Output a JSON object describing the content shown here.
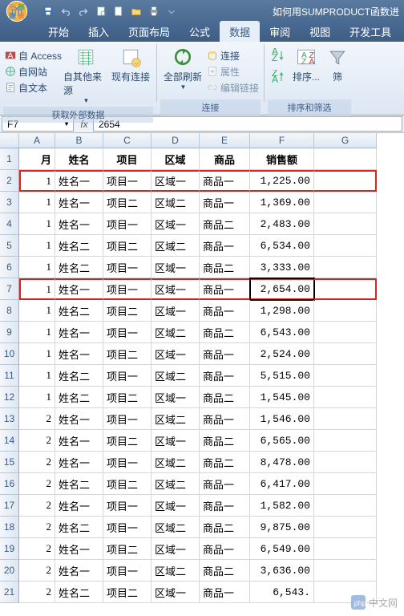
{
  "window": {
    "title": "如何用SUMPRODUCT函数进"
  },
  "tabs": [
    "开始",
    "插入",
    "页面布局",
    "公式",
    "数据",
    "审阅",
    "视图",
    "开发工具"
  ],
  "active_tab": 4,
  "ribbon": {
    "group1": {
      "label": "获取外部数据",
      "access": "自 Access",
      "web": "自网站",
      "text": "自文本",
      "other": "自其他来源",
      "existing": "现有连接"
    },
    "group2": {
      "label": "连接",
      "refresh": "全部刷新",
      "conn": "连接",
      "prop": "属性",
      "edit": "编辑链接"
    },
    "group3": {
      "label": "排序和筛选",
      "sort": "排序...",
      "filter": "筛"
    }
  },
  "namebox": "F7",
  "formula": "2654",
  "columns": [
    "",
    "A",
    "B",
    "C",
    "D",
    "E",
    "F",
    "G"
  ],
  "headers": [
    "月",
    "姓名",
    "项目",
    "区域",
    "商品",
    "销售额"
  ],
  "rows": [
    {
      "n": 1,
      "m": "1",
      "name": "姓名一",
      "proj": "项目一",
      "zone": "区域一",
      "prod": "商品一",
      "sales": "1,225.00",
      "hl": true
    },
    {
      "n": 2,
      "m": "1",
      "name": "姓名一",
      "proj": "项目二",
      "zone": "区域二",
      "prod": "商品一",
      "sales": "1,369.00"
    },
    {
      "n": 3,
      "m": "1",
      "name": "姓名一",
      "proj": "项目一",
      "zone": "区域一",
      "prod": "商品二",
      "sales": "2,483.00"
    },
    {
      "n": 4,
      "m": "1",
      "name": "姓名二",
      "proj": "项目二",
      "zone": "区域二",
      "prod": "商品一",
      "sales": "6,534.00"
    },
    {
      "n": 5,
      "m": "1",
      "name": "姓名二",
      "proj": "项目一",
      "zone": "区域一",
      "prod": "商品二",
      "sales": "3,333.00"
    },
    {
      "n": 6,
      "m": "1",
      "name": "姓名一",
      "proj": "项目一",
      "zone": "区域一",
      "prod": "商品一",
      "sales": "2,654.00",
      "hl": true,
      "active": true
    },
    {
      "n": 7,
      "m": "1",
      "name": "姓名二",
      "proj": "项目二",
      "zone": "区域一",
      "prod": "商品一",
      "sales": "1,298.00"
    },
    {
      "n": 8,
      "m": "1",
      "name": "姓名一",
      "proj": "项目一",
      "zone": "区域二",
      "prod": "商品二",
      "sales": "6,543.00"
    },
    {
      "n": 9,
      "m": "1",
      "name": "姓名一",
      "proj": "项目二",
      "zone": "区域一",
      "prod": "商品一",
      "sales": "2,524.00"
    },
    {
      "n": 10,
      "m": "1",
      "name": "姓名二",
      "proj": "项目一",
      "zone": "区域二",
      "prod": "商品一",
      "sales": "5,515.00"
    },
    {
      "n": 11,
      "m": "1",
      "name": "姓名二",
      "proj": "项目二",
      "zone": "区域一",
      "prod": "商品二",
      "sales": "1,545.00"
    },
    {
      "n": 12,
      "m": "2",
      "name": "姓名一",
      "proj": "项目一",
      "zone": "区域二",
      "prod": "商品一",
      "sales": "1,546.00"
    },
    {
      "n": 13,
      "m": "2",
      "name": "姓名一",
      "proj": "项目二",
      "zone": "区域一",
      "prod": "商品二",
      "sales": "6,565.00"
    },
    {
      "n": 14,
      "m": "2",
      "name": "姓名一",
      "proj": "项目一",
      "zone": "区域二",
      "prod": "商品二",
      "sales": "8,478.00"
    },
    {
      "n": 15,
      "m": "2",
      "name": "姓名二",
      "proj": "项目二",
      "zone": "区域二",
      "prod": "商品一",
      "sales": "6,417.00"
    },
    {
      "n": 16,
      "m": "2",
      "name": "姓名一",
      "proj": "项目一",
      "zone": "区域一",
      "prod": "商品一",
      "sales": "1,582.00"
    },
    {
      "n": 17,
      "m": "2",
      "name": "姓名二",
      "proj": "项目一",
      "zone": "区域二",
      "prod": "商品二",
      "sales": "9,875.00"
    },
    {
      "n": 18,
      "m": "2",
      "name": "姓名一",
      "proj": "项目二",
      "zone": "区域一",
      "prod": "商品一",
      "sales": "6,549.00"
    },
    {
      "n": 19,
      "m": "2",
      "name": "姓名一",
      "proj": "项目一",
      "zone": "区域二",
      "prod": "商品二",
      "sales": "3,636.00"
    },
    {
      "n": 20,
      "m": "2",
      "name": "姓名二",
      "proj": "项目二",
      "zone": "区域一",
      "prod": "商品一",
      "sales": "6,543."
    }
  ],
  "watermark": "中文网"
}
